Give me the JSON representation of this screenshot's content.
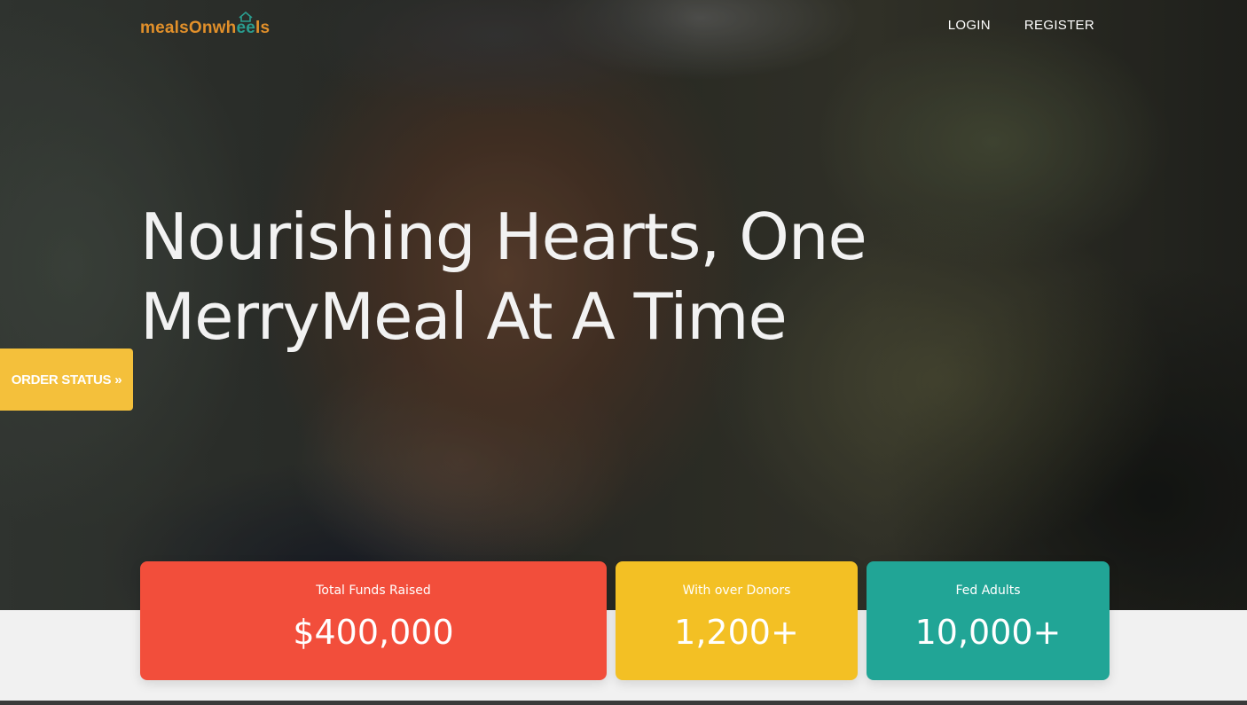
{
  "brand": {
    "logo_part1": "mealsOnwh",
    "logo_part2": "ee",
    "logo_part3": "ls",
    "primary_color": "#e2902a",
    "accent_color": "#2a9d8f"
  },
  "nav": {
    "login_label": "LOGIN",
    "register_label": "REGISTER"
  },
  "hero": {
    "headline_line1": "Nourishing Hearts, One",
    "headline_line2": "MerryMeal At A Time"
  },
  "order_status": {
    "label": "ORDER STATUS",
    "chevron": "»",
    "color": "#f4c03b"
  },
  "stats": [
    {
      "label": "Total Funds Raised",
      "value": "$400,000",
      "color": "#f24e3b"
    },
    {
      "label": "With over Donors",
      "value": "1,200+",
      "color": "#f3c024"
    },
    {
      "label": "Fed Adults",
      "value": "10,000+",
      "color": "#21a596"
    }
  ]
}
